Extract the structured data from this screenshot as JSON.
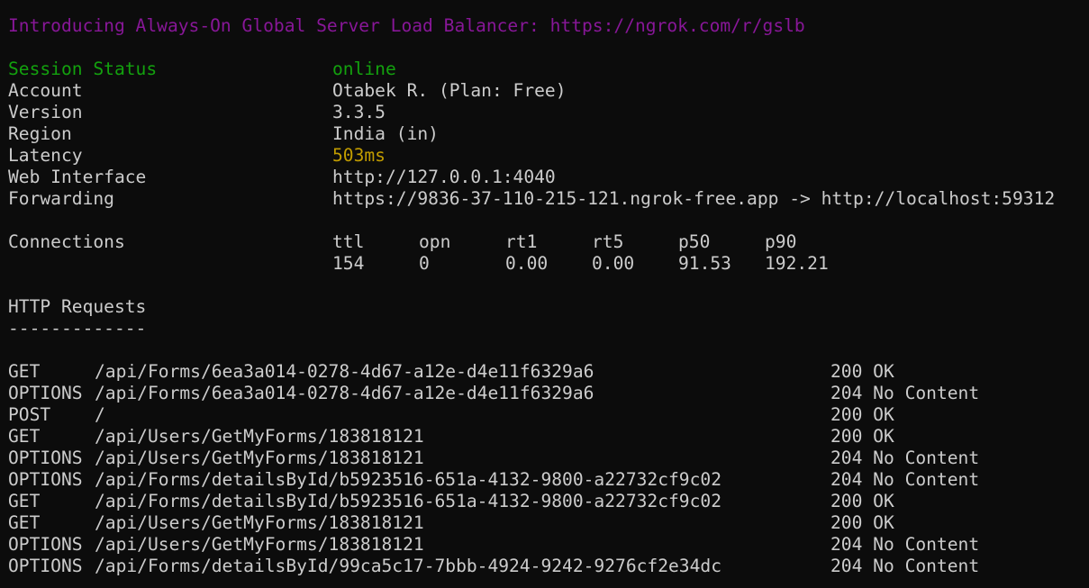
{
  "banner": "Introducing Always-On Global Server Load Balancer: https://ngrok.com/r/gslb",
  "status": [
    {
      "key": "Session Status",
      "value": "online"
    },
    {
      "key": "Account",
      "value": "Otabek R. (Plan: Free)"
    },
    {
      "key": "Version",
      "value": "3.3.5"
    },
    {
      "key": "Region",
      "value": "India (in)"
    },
    {
      "key": "Latency",
      "value": "503ms"
    },
    {
      "key": "Web Interface",
      "value": "http://127.0.0.1:4040"
    },
    {
      "key": "Forwarding",
      "value": "https://9836-37-110-215-121.ngrok-free.app -> http://localhost:59312"
    }
  ],
  "connections": {
    "label": "Connections",
    "headers": [
      "ttl",
      "opn",
      "rt1",
      "rt5",
      "p50",
      "p90"
    ],
    "values": [
      "154",
      "0",
      "0.00",
      "0.00",
      "91.53",
      "192.21"
    ]
  },
  "http": {
    "title": "HTTP Requests",
    "divider": "-------------",
    "requests": [
      {
        "method": "GET",
        "path": "/api/Forms/6ea3a014-0278-4d67-a12e-d4e11f6329a6",
        "status": "200 OK"
      },
      {
        "method": "OPTIONS",
        "path": "/api/Forms/6ea3a014-0278-4d67-a12e-d4e11f6329a6",
        "status": "204 No Content"
      },
      {
        "method": "POST",
        "path": "/",
        "status": "200 OK"
      },
      {
        "method": "GET",
        "path": "/api/Users/GetMyForms/183818121",
        "status": "200 OK"
      },
      {
        "method": "OPTIONS",
        "path": "/api/Users/GetMyForms/183818121",
        "status": "204 No Content"
      },
      {
        "method": "OPTIONS",
        "path": "/api/Forms/detailsById/b5923516-651a-4132-9800-a22732cf9c02",
        "status": "204 No Content"
      },
      {
        "method": "GET",
        "path": "/api/Forms/detailsById/b5923516-651a-4132-9800-a22732cf9c02",
        "status": "200 OK"
      },
      {
        "method": "GET",
        "path": "/api/Users/GetMyForms/183818121",
        "status": "200 OK"
      },
      {
        "method": "OPTIONS",
        "path": "/api/Users/GetMyForms/183818121",
        "status": "204 No Content"
      },
      {
        "method": "OPTIONS",
        "path": "/api/Forms/detailsById/99ca5c17-7bbb-4924-9242-9276cf2e34dc",
        "status": "204 No Content"
      }
    ]
  },
  "colors": {
    "background": "#0c0c0c",
    "text": "#cccccc",
    "banner": "#881798",
    "online": "#13a10e",
    "latency": "#c19c00"
  }
}
